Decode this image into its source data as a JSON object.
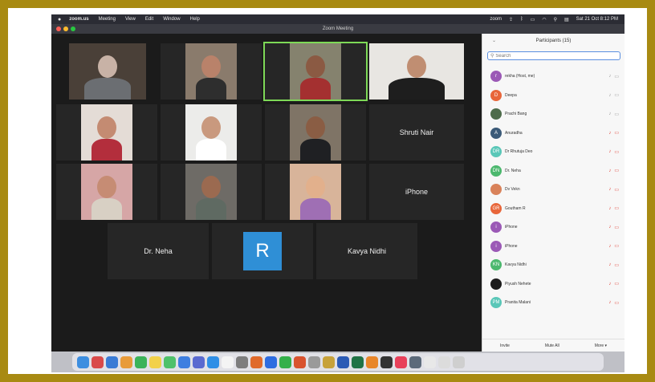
{
  "menubar": {
    "app": "zoom.us",
    "items": [
      "Meeting",
      "View",
      "Edit",
      "Window",
      "Help"
    ],
    "status_app": "zoom",
    "datetime": "Sat 21 Oct 8:12 PM"
  },
  "window": {
    "title": "Zoom Meeting"
  },
  "gallery": {
    "tiles": [
      {
        "kind": "video",
        "bg": "#4a4038",
        "skin": "#c8b2a6",
        "cloth": "#6b6e72"
      },
      {
        "kind": "video",
        "bg": "#8a7b6c",
        "skin": "#b9826a",
        "cloth": "#2e2e2e"
      },
      {
        "kind": "video",
        "bg": "#85826e",
        "skin": "#8b5a43",
        "cloth": "#a43030"
      },
      {
        "kind": "video",
        "bg": "#e8e6e2",
        "skin": "#c08e72",
        "cloth": "#1e1e1e"
      },
      {
        "kind": "video",
        "bg": "#e4dcd6",
        "skin": "#c48b72",
        "cloth": "#b32e3c"
      },
      {
        "kind": "video",
        "bg": "#ececea",
        "skin": "#c9997e",
        "cloth": "#ffffff"
      },
      {
        "kind": "video",
        "bg": "#7f7466",
        "skin": "#8a5d44",
        "cloth": "#1f2023"
      },
      {
        "kind": "name",
        "label": "Shruti Nair"
      },
      {
        "kind": "video",
        "bg": "#d6a6a6",
        "skin": "#c68c74",
        "cloth": "#d8d0c4"
      },
      {
        "kind": "video",
        "bg": "#6e6b66",
        "skin": "#9b6a50",
        "cloth": "#5f6a62"
      },
      {
        "kind": "video",
        "bg": "#d8b49a",
        "skin": "#e2b08c",
        "cloth": "#9f6fb4"
      },
      {
        "kind": "name",
        "label": "iPhone"
      },
      {
        "kind": "name",
        "label": "Dr. Neha"
      },
      {
        "kind": "avatar",
        "letter": "R"
      },
      {
        "kind": "name",
        "label": "Kavya Nidhi"
      }
    ]
  },
  "panel": {
    "title": "Participants (15)",
    "search_placeholder": "Search",
    "participants": [
      {
        "initials": "r",
        "name": "rekha (Host, me)",
        "color": "#9b59b6",
        "mic": "on"
      },
      {
        "initials": "D",
        "name": "Deepa",
        "color": "#e8663a",
        "mic": "on"
      },
      {
        "initials": "",
        "name": "Prachi Bang",
        "color": "#4d6b4a",
        "mic": "on"
      },
      {
        "initials": "A",
        "name": "Anuradha",
        "color": "#3b5a78",
        "mic": "muted"
      },
      {
        "initials": "DR",
        "name": "Dr Rhutuja Deo",
        "color": "#5ac7b8",
        "mic": "muted"
      },
      {
        "initials": "DN",
        "name": "Dr. Neha",
        "color": "#4cb86e",
        "mic": "muted"
      },
      {
        "initials": "",
        "name": "Dv Vekn",
        "color": "#d9825a",
        "mic": "muted"
      },
      {
        "initials": "GR",
        "name": "Goutham R",
        "color": "#e8663a",
        "mic": "muted"
      },
      {
        "initials": "i",
        "name": "iPhone",
        "color": "#9b59b6",
        "mic": "muted"
      },
      {
        "initials": "i",
        "name": "iPhone",
        "color": "#9b59b6",
        "mic": "muted"
      },
      {
        "initials": "KN",
        "name": "Kavya Nidhi",
        "color": "#4cb86e",
        "mic": "muted"
      },
      {
        "initials": "",
        "name": "Piyush Nehete",
        "color": "#1c1c1c",
        "mic": "muted"
      },
      {
        "initials": "PM",
        "name": "Pranita Malani",
        "color": "#5ac7b8",
        "mic": "muted"
      }
    ],
    "footer": {
      "invite": "Invite",
      "mute_all": "Mute All",
      "more": "More ▾"
    }
  },
  "dock": {
    "icons": [
      {
        "name": "finder-icon",
        "color": "#3d8ee0"
      },
      {
        "name": "launchpad-icon",
        "color": "#d94a4a"
      },
      {
        "name": "mail-icon",
        "color": "#3a7bd5"
      },
      {
        "name": "photos-icon",
        "color": "#e89b3a"
      },
      {
        "name": "facetime-icon",
        "color": "#3bb35a"
      },
      {
        "name": "notes-icon",
        "color": "#f2d14a"
      },
      {
        "name": "messages-icon",
        "color": "#4fc16a"
      },
      {
        "name": "app-icon-blue",
        "color": "#3f7fe0"
      },
      {
        "name": "star-icon",
        "color": "#5a6ad0"
      },
      {
        "name": "appstore-icon",
        "color": "#2f8fe6"
      },
      {
        "name": "calendar-icon",
        "color": "#f4f4f4"
      },
      {
        "name": "settings-icon",
        "color": "#7d7d7d"
      },
      {
        "name": "firefox-icon",
        "color": "#e06a2a"
      },
      {
        "name": "zoom-icon",
        "color": "#2d6ce0"
      },
      {
        "name": "whatsapp-icon",
        "color": "#34b04a"
      },
      {
        "name": "app-icon-red",
        "color": "#d9532f"
      },
      {
        "name": "help-icon",
        "color": "#9a9a9a"
      },
      {
        "name": "app-icon-multi",
        "color": "#c7a23a"
      },
      {
        "name": "word-icon",
        "color": "#2b5bb5"
      },
      {
        "name": "excel-icon",
        "color": "#217346"
      },
      {
        "name": "vlc-icon",
        "color": "#e8862a"
      },
      {
        "name": "app-icon-dark",
        "color": "#333333"
      },
      {
        "name": "music-icon",
        "color": "#e8405a"
      },
      {
        "name": "app-icon-grey",
        "color": "#5c6a7a"
      },
      {
        "name": "document-icon",
        "color": "#e8e8e8"
      },
      {
        "name": "screenshot-icon",
        "color": "#dcdcdc"
      },
      {
        "name": "trash-icon",
        "color": "#cfcfcf"
      }
    ]
  }
}
